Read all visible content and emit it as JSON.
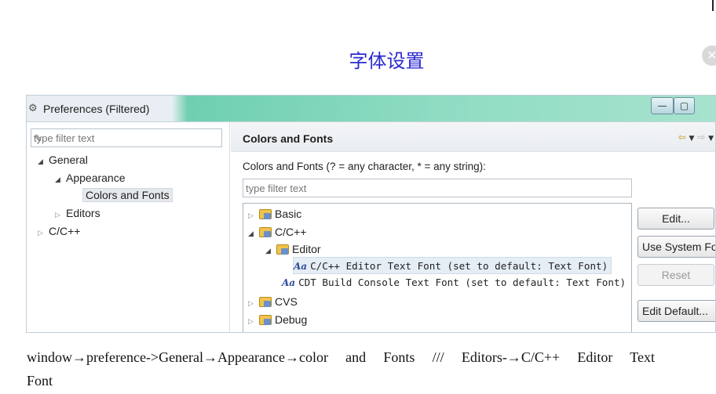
{
  "page": {
    "title": "字体设置",
    "caption_line1": "window→preference->General→Appearance→color and Fonts /// Editors-→C/C++ Editor Text",
    "caption_line2": "Font"
  },
  "window": {
    "title": "Preferences (Filtered)",
    "buttons": {
      "minimize": "—",
      "maximize": "▢"
    }
  },
  "left": {
    "filter_placeholder": "type filter text",
    "tree": {
      "general": "General",
      "appearance": "Appearance",
      "colors_and_fonts": "Colors and Fonts",
      "editors": "Editors",
      "cpp": "C/C++"
    }
  },
  "right": {
    "section_title": "Colors and Fonts",
    "description": "Colors and Fonts (? = any character, * = any string):",
    "filter_placeholder": "type filter text",
    "tree": {
      "basic": "Basic",
      "cpp": "C/C++",
      "editor": "Editor",
      "editor_text_font": "C/C++ Editor Text Font (set to default: Text Font)",
      "cdt_console_font": "CDT Build Console Text Font (set to default: Text Font)",
      "cvs": "CVS",
      "debug": "Debug"
    },
    "aa_label": "Aa",
    "buttons": {
      "edit": "Edit...",
      "use_system_font": "Use System Font",
      "reset": "Reset",
      "edit_default": "Edit Default..."
    }
  },
  "colors": {
    "title_blue": "#2a2ad0",
    "titlebar_teal": "#8fdcc3",
    "folder_yellow": "#f1c34b",
    "nav_arrow": "#c79a1d"
  },
  "icons": [
    "preferences-icon",
    "eraser-icon",
    "back-arrow-icon",
    "forward-arrow-icon",
    "folder-icon",
    "font-icon",
    "close-icon"
  ]
}
